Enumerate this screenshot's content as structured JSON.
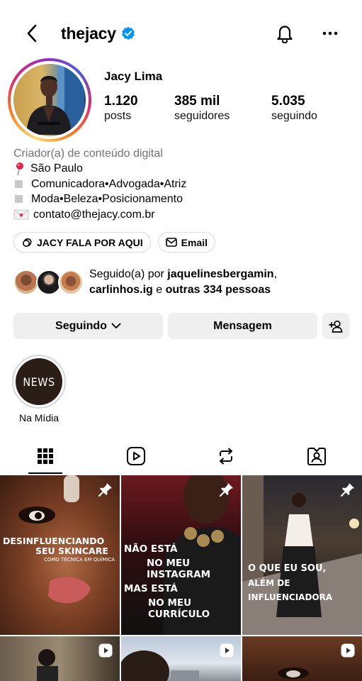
{
  "header": {
    "username": "thejacy",
    "icons": [
      "back-arrow-icon",
      "verified-badge-icon",
      "bell-icon",
      "more-horizontal-icon"
    ]
  },
  "profile": {
    "display_name": "Jacy Lima",
    "stats": [
      {
        "value": "1.120",
        "label": "posts"
      },
      {
        "value": "385 mil",
        "label": "seguidores"
      },
      {
        "value": "5.035",
        "label": "seguindo"
      }
    ],
    "bio": {
      "category": "Criador(a) de conteúdo digital",
      "location": "São Paulo",
      "line1": "Comunicadora•Advogada•Atriz",
      "line2": "Moda•Beleza•Posicionamento",
      "email": "contato@thejacy.com.br"
    },
    "links": [
      {
        "label": "JACY FALA POR AQUI",
        "icon": "threads-icon"
      },
      {
        "label": "Email",
        "icon": "mail-icon"
      }
    ],
    "followed_by": {
      "prefix": "Seguido(a) por ",
      "user1": "jaquelinesbergamin",
      "sep": ",",
      "user2": "carlinhos.ig",
      "middle": " e ",
      "others": "outras 334 pessoas"
    }
  },
  "actions": {
    "following": "Seguindo",
    "message": "Mensagem",
    "add_icon": "add-person-icon"
  },
  "highlights": [
    {
      "cover_text": "NEWS",
      "label": "Na Mídia"
    }
  ],
  "tabs": [
    "grid-icon",
    "reels-icon",
    "reposts-icon",
    "tagged-icon"
  ],
  "posts": [
    {
      "line1": "DESINFLUENCIANDO",
      "line2": "SEU SKINCARE",
      "line3": "COMO TÉCNICA EM QUÍMICA",
      "pinned": true
    },
    {
      "line1": "NÃO ESTÁ",
      "line2": "NO MEU INSTAGRAM",
      "line3": "MAS ESTÁ",
      "line4": "NO MEU CURRÍCULO",
      "pinned": true
    },
    {
      "line1": "O QUE EU SOU,",
      "line2": "ALÉM DE INFLUENCIADORA",
      "pinned": true
    },
    {
      "reel": true
    },
    {
      "reel": true
    },
    {
      "reel": true
    }
  ]
}
